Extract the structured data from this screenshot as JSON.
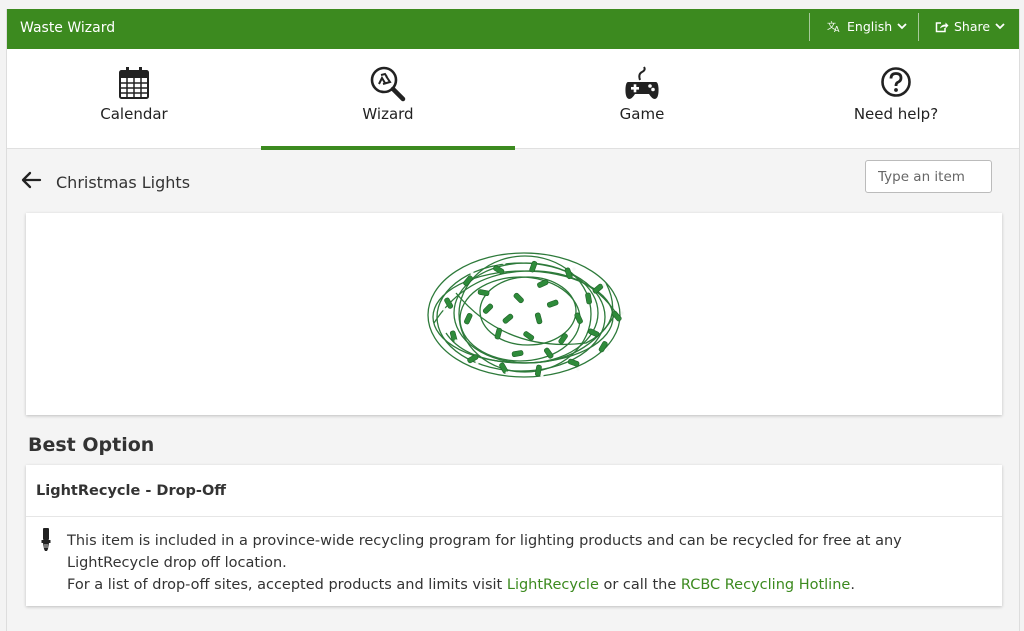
{
  "app": {
    "title": "Waste Wizard"
  },
  "header": {
    "language_label": "English",
    "share_label": "Share"
  },
  "nav": {
    "items": [
      {
        "label": "Calendar",
        "icon": "calendar-icon"
      },
      {
        "label": "Wizard",
        "icon": "recycle-search-icon",
        "active": true
      },
      {
        "label": "Game",
        "icon": "gamepad-icon"
      },
      {
        "label": "Need help?",
        "icon": "help-circle-icon"
      }
    ]
  },
  "item": {
    "title": "Christmas Lights",
    "search_placeholder": "Type an item"
  },
  "best_option": {
    "heading": "Best Option",
    "title": "LightRecycle - Drop-Off",
    "text_1": "This item is included in a province-wide recycling program for lighting products and can be recycled for free at any LightRecycle drop off location.",
    "text_2a": "For a list of drop-off sites, accepted products and limits visit ",
    "link_1": "LightRecycle",
    "text_2b": " or call the ",
    "link_2": "RCBC Recycling Hotline",
    "text_2c": "."
  },
  "colors": {
    "brand_green": "#3c8a1f",
    "light_green": "#2e8b3a"
  }
}
